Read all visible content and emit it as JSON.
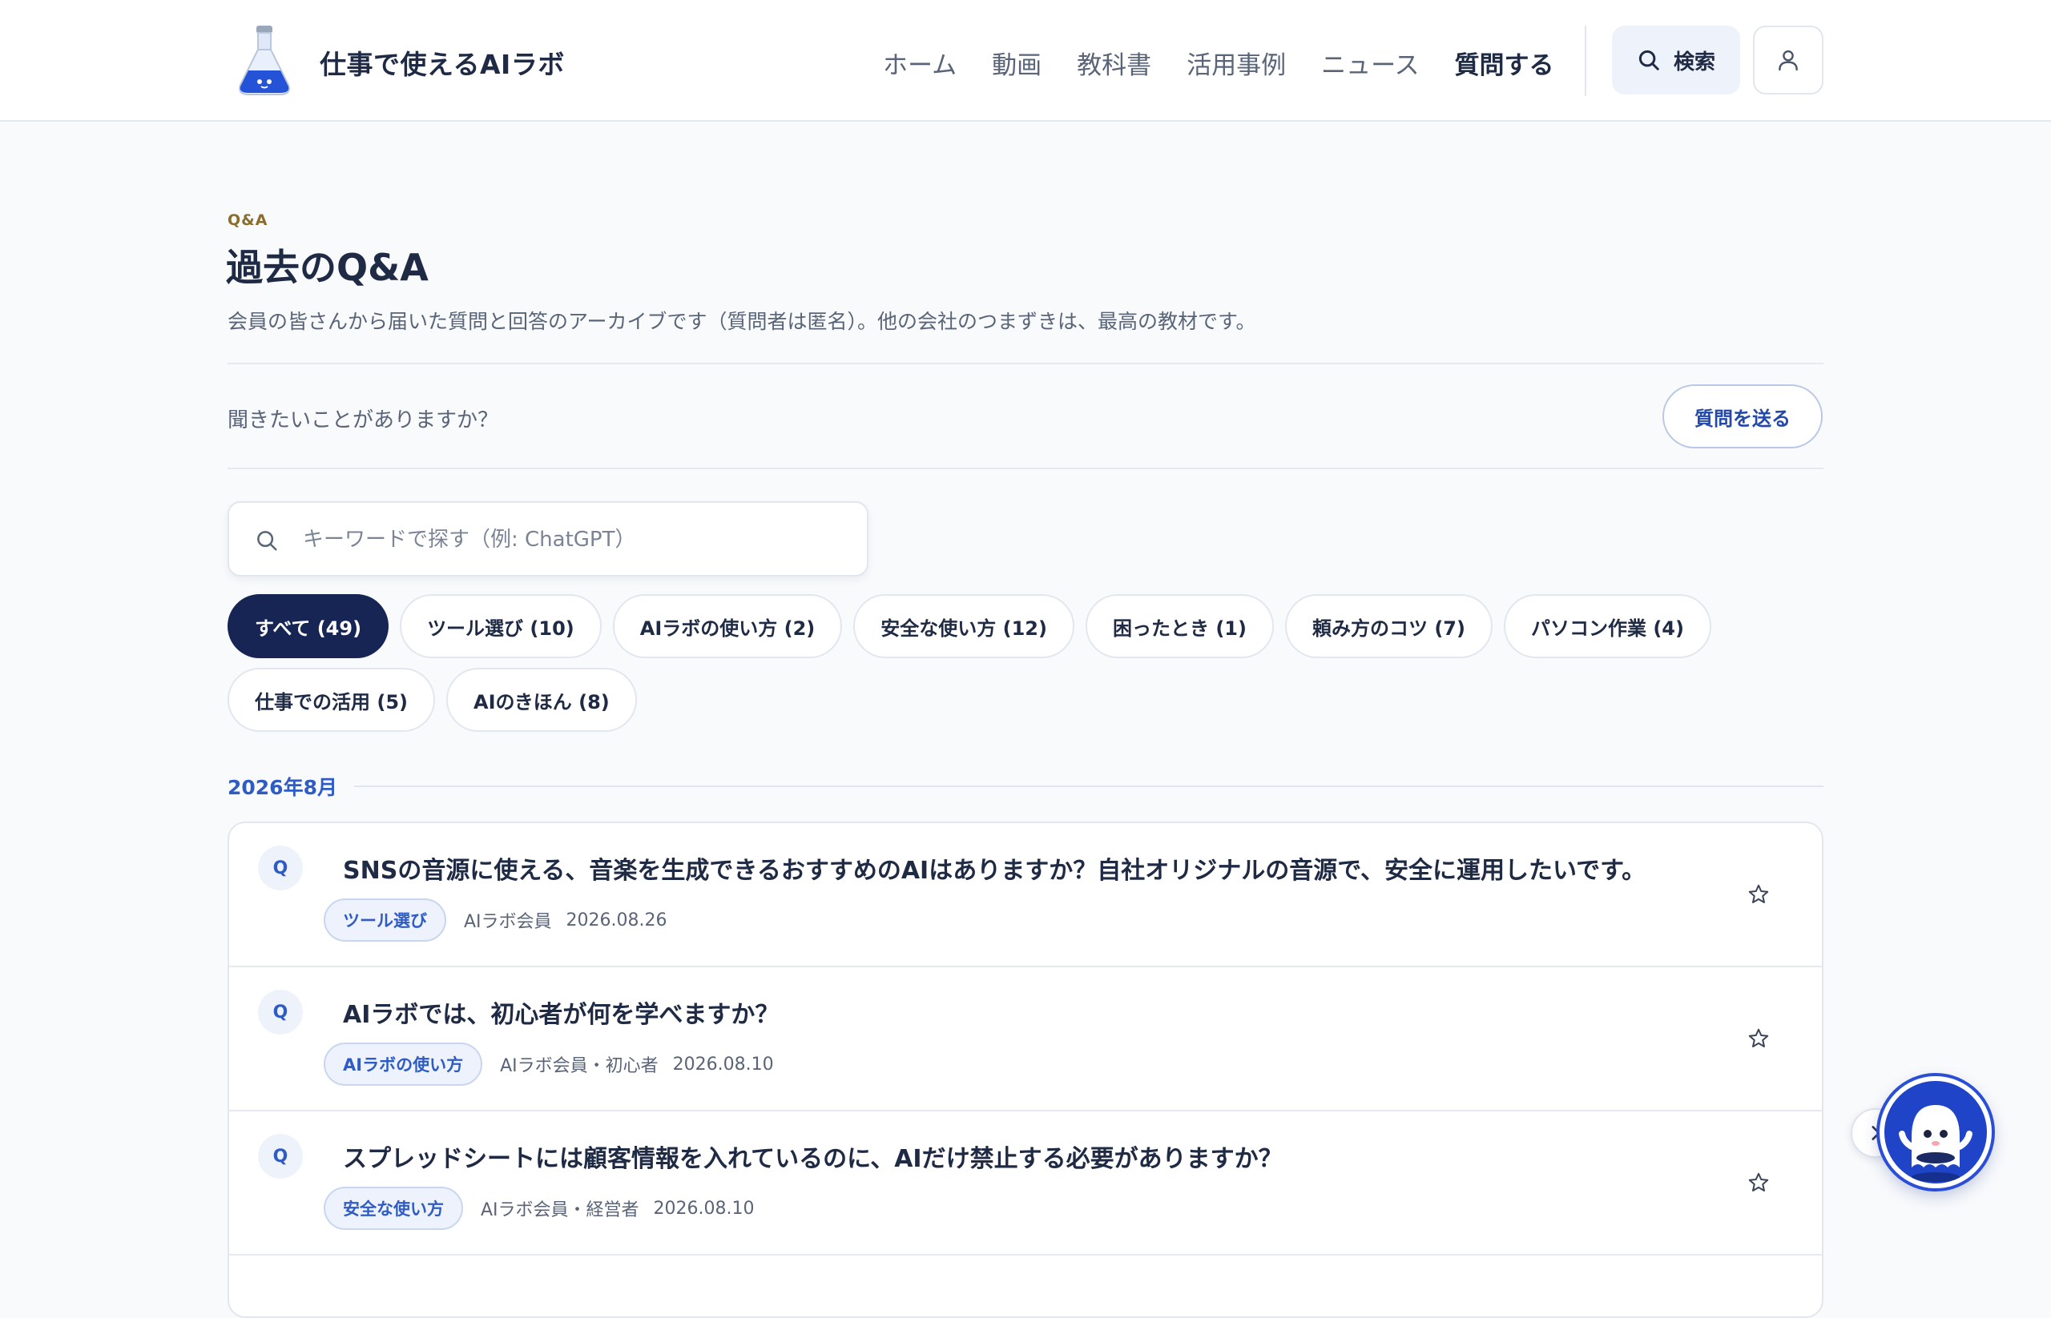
{
  "header": {
    "brand": "仕事で使えるAIラボ",
    "nav": [
      "ホーム",
      "動画",
      "教科書",
      "活用事例",
      "ニュース",
      "質問する"
    ],
    "search_label": "検索"
  },
  "intro": {
    "eyebrow": "Q&A",
    "title": "過去のQ&A",
    "description": "会員の皆さんから届いた質問と回答のアーカイブです（質問者は匿名）。他の会社のつまずきは、最高の教材です。"
  },
  "ask": {
    "text": "聞きたいことがありますか？",
    "button": "質問を送る"
  },
  "search": {
    "placeholder": "キーワードで探す（例: ChatGPT）"
  },
  "filters": [
    "すべて (49)",
    "ツール選び (10)",
    "AIラボの使い方 (2)",
    "安全な使い方 (12)",
    "困ったとき (1)",
    "頼み方のコツ (7)",
    "パソコン作業 (4)",
    "仕事での活用 (5)",
    "AIのきほん (8)"
  ],
  "month": "2026年8月",
  "questions": [
    {
      "badge": "Q",
      "title": "SNSの音源に使える、音楽を生成できるおすすめのAIはありますか？自社オリジナルの音源で、安全に運用したいです。",
      "tag": "ツール選び",
      "author": "AIラボ会員",
      "date": "2026.08.26"
    },
    {
      "badge": "Q",
      "title": "AIラボでは、初心者が何を学べますか？",
      "tag": "AIラボの使い方",
      "author": "AIラボ会員・初心者",
      "date": "2026.08.10"
    },
    {
      "badge": "Q",
      "title": "スプレッドシートには顧客情報を入れているのに、AIだけ禁止する必要がありますか？",
      "tag": "安全な使い方",
      "author": "AIラボ会員・経営者",
      "date": "2026.08.10"
    }
  ],
  "colors": {
    "accent": "#2f5bc4",
    "active_chip": "#162554",
    "eyebrow": "#8a6d2c"
  }
}
